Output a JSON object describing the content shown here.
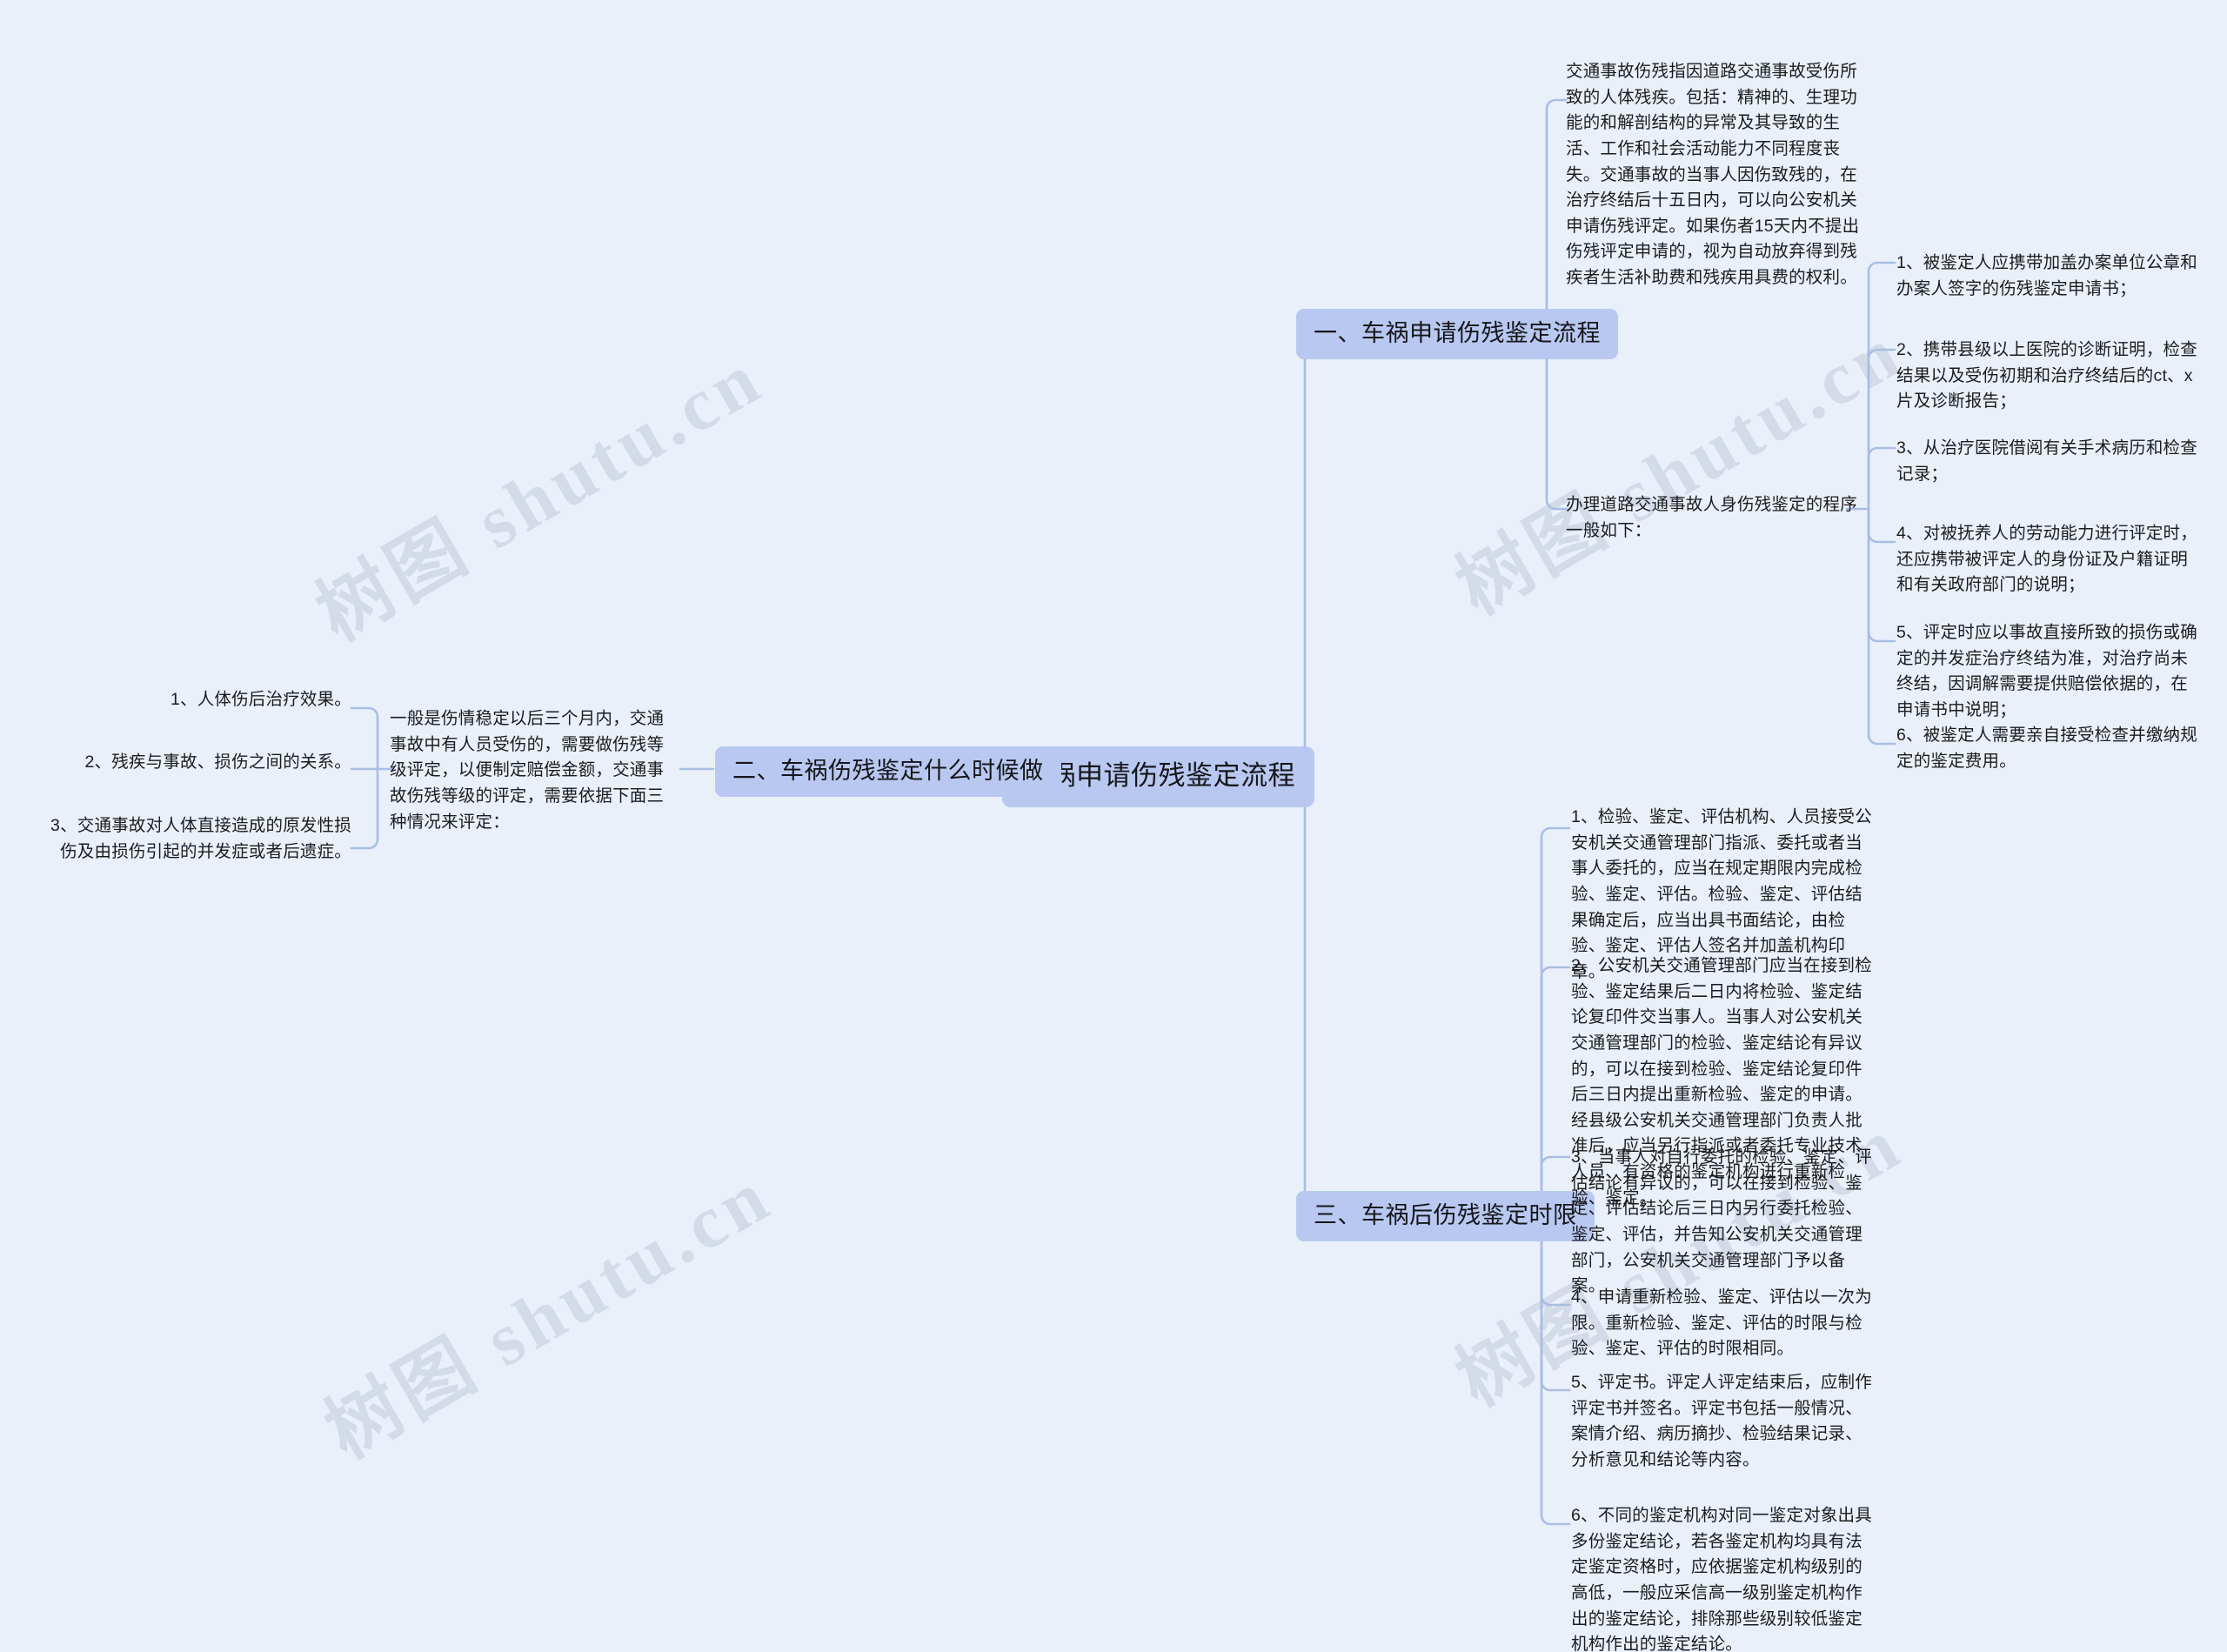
{
  "meta": {
    "watermark_text": "树图 shutu.cn",
    "accent_node_color": "#b8c8f0",
    "background_color": "#eaf0fa",
    "line_color": "#a9bde4",
    "text_color": "#1d1d1f"
  },
  "root": {
    "label": "车祸申请伤残鉴定流程"
  },
  "branches": {
    "one": {
      "label": "一、车祸申请伤残鉴定流程",
      "intro": "交通事故伤残指因道路交通事故受伤所致的人体残疾。包括：精神的、生理功能的和解剖结构的异常及其导致的生活、工作和社会活动能力不同程度丧失。交通事故的当事人因伤致残的，在治疗终结后十五日内，可以向公安机关申请伤残评定。如果伤者15天内不提出伤残评定申请的，视为自动放弃得到残疾者生活补助费和残疾用具费的权利。",
      "procedure_lead": "办理道路交通事故人身伤残鉴定的程序一般如下：",
      "procedure_items": [
        "1、被鉴定人应携带加盖办案单位公章和办案人签字的伤残鉴定申请书；",
        "2、携带县级以上医院的诊断证明，检查结果以及受伤初期和治疗终结后的ct、x片及诊断报告；",
        "3、从治疗医院借阅有关手术病历和检查记录；",
        "4、对被抚养人的劳动能力进行评定时，还应携带被评定人的身份证及户籍证明和有关政府部门的说明；",
        "5、评定时应以事故直接所致的损伤或确定的并发症治疗终结为准，对治疗尚未终结，因调解需要提供赔偿依据的，在申请书中说明；",
        "6、被鉴定人需要亲自接受检查并缴纳规定的鉴定费用。"
      ]
    },
    "two": {
      "label": "二、车祸伤残鉴定什么时候做",
      "lead": "一般是伤情稳定以后三个月内，交通事故中有人员受伤的，需要做伤残等级评定，以便制定赔偿金额，交通事故伤残等级的评定，需要依据下面三种情况来评定：",
      "items": [
        "1、人体伤后治疗效果。",
        "2、残疾与事故、损伤之间的关系。",
        "3、交通事故对人体直接造成的原发性损伤及由损伤引起的并发症或者后遗症。"
      ]
    },
    "three": {
      "label": "三、车祸后伤残鉴定时限",
      "items": [
        "1、检验、鉴定、评估机构、人员接受公安机关交通管理部门指派、委托或者当事人委托的，应当在规定期限内完成检验、鉴定、评估。检验、鉴定、评估结果确定后，应当出具书面结论，由检验、鉴定、评估人签名并加盖机构印章。",
        "2、公安机关交通管理部门应当在接到检验、鉴定结果后二日内将检验、鉴定结论复印件交当事人。当事人对公安机关交通管理部门的检验、鉴定结论有异议的，可以在接到检验、鉴定结论复印件后三日内提出重新检验、鉴定的申请。经县级公安机关交通管理部门负责人批准后，应当另行指派或者委托专业技术人员、有资格的鉴定机构进行重新检验、鉴定。",
        "3、当事人对自行委托的检验、鉴定、评估结论有异议的，可以在接到检验、鉴定、评估结论后三日内另行委托检验、鉴定、评估，并告知公安机关交通管理部门，公安机关交通管理部门予以备案。",
        "4、申请重新检验、鉴定、评估以一次为限。重新检验、鉴定、评估的时限与检验、鉴定、评估的时限相同。",
        "5、评定书。评定人评定结束后，应制作评定书并签名。评定书包括一般情况、案情介绍、病历摘抄、检验结果记录、分析意见和结论等内容。",
        "6、不同的鉴定机构对同一鉴定对象出具多份鉴定结论，若各鉴定机构均具有法定鉴定资格时，应依据鉴定机构级别的高低，一般应采信高一级别鉴定机构作出的鉴定结论，排除那些级别较低鉴定机构作出的鉴定结论。"
      ]
    }
  }
}
